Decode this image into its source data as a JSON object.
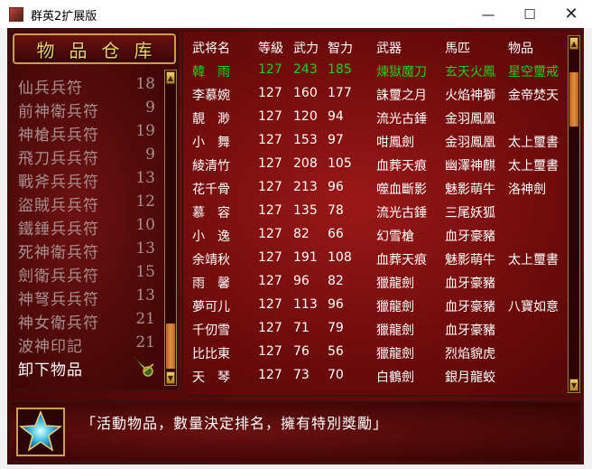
{
  "window": {
    "title": "群英2扩展版",
    "min": "—",
    "max": "☐",
    "close": "✕"
  },
  "left": {
    "title": "物品仓库",
    "items": [
      {
        "name": "仙兵兵符",
        "count": "18"
      },
      {
        "name": "前神衛兵符",
        "count": "9"
      },
      {
        "name": "神槍兵兵符",
        "count": "19"
      },
      {
        "name": "飛刀兵兵符",
        "count": "9"
      },
      {
        "name": "戰斧兵兵符",
        "count": "13"
      },
      {
        "name": "盜賊兵兵符",
        "count": "12"
      },
      {
        "name": "鐵錘兵兵符",
        "count": "10"
      },
      {
        "name": "死神衛兵符",
        "count": "13"
      },
      {
        "name": "劍衛兵兵符",
        "count": "15"
      },
      {
        "name": "神弩兵兵符",
        "count": "13"
      },
      {
        "name": "神女衛兵符",
        "count": "21"
      },
      {
        "name": "波神印記",
        "count": "21"
      },
      {
        "name": "卸下物品",
        "count": ""
      }
    ]
  },
  "table": {
    "headers": {
      "name": "武将名",
      "level": "等級",
      "atk": "武力",
      "int": "智力",
      "weapon": "武器",
      "horse": "馬匹",
      "item": "物品"
    },
    "rows": [
      {
        "name": "韓　雨",
        "level": "127",
        "atk": "243",
        "int": "185",
        "weapon": "煉獄魔刀",
        "horse": "玄天火鳳",
        "item": "星空璽戒",
        "hl": true
      },
      {
        "name": "李慕婉",
        "level": "127",
        "atk": "160",
        "int": "177",
        "weapon": "誅璽之月",
        "horse": "火焰神獅",
        "item": "金帝焚天",
        "hl": false
      },
      {
        "name": "靚　渺",
        "level": "127",
        "atk": "120",
        "int": "94",
        "weapon": "流光古錘",
        "horse": "金羽鳳凰",
        "item": "",
        "hl": false
      },
      {
        "name": "小　舞",
        "level": "127",
        "atk": "153",
        "int": "97",
        "weapon": "咁鳳劍",
        "horse": "金羽鳳凰",
        "item": "太上璽書",
        "hl": false
      },
      {
        "name": "綾清竹",
        "level": "127",
        "atk": "208",
        "int": "105",
        "weapon": "血葬天痕",
        "horse": "幽澤神麒",
        "item": "太上璽書",
        "hl": false
      },
      {
        "name": "花千骨",
        "level": "127",
        "atk": "213",
        "int": "96",
        "weapon": "噬血斷影",
        "horse": "魅影萌牛",
        "item": "洛神劍",
        "hl": false
      },
      {
        "name": "慕　容",
        "level": "127",
        "atk": "135",
        "int": "78",
        "weapon": "流光古錘",
        "horse": "三尾妖狐",
        "item": "",
        "hl": false
      },
      {
        "name": "小　逸",
        "level": "127",
        "atk": "82",
        "int": "66",
        "weapon": "幻雪槍",
        "horse": "血牙豪豬",
        "item": "",
        "hl": false
      },
      {
        "name": "余靖秋",
        "level": "127",
        "atk": "191",
        "int": "108",
        "weapon": "血葬天痕",
        "horse": "魅影萌牛",
        "item": "太上璽書",
        "hl": false
      },
      {
        "name": "雨　馨",
        "level": "127",
        "atk": "96",
        "int": "82",
        "weapon": "獵龍劍",
        "horse": "血牙豪豬",
        "item": "",
        "hl": false
      },
      {
        "name": "夢可儿",
        "level": "127",
        "atk": "113",
        "int": "96",
        "weapon": "獵龍劍",
        "horse": "血牙豪豬",
        "item": "八寶如意",
        "hl": false
      },
      {
        "name": "千仞雪",
        "level": "127",
        "atk": "71",
        "int": "79",
        "weapon": "獵龍劍",
        "horse": "血牙豪豬",
        "item": "",
        "hl": false
      },
      {
        "name": "比比東",
        "level": "127",
        "atk": "76",
        "int": "56",
        "weapon": "獵龍劍",
        "horse": "烈焰貌虎",
        "item": "",
        "hl": false
      },
      {
        "name": "天　琴",
        "level": "127",
        "atk": "73",
        "int": "70",
        "weapon": "白鶴劍",
        "horse": "銀月龍蛟",
        "item": "",
        "hl": false
      }
    ]
  },
  "message": "「活動物品，數量決定排名，擁有特別獎勵」",
  "colors": {
    "highlight": "#20d020",
    "text": "#ffffff",
    "dim": "#a89090",
    "gold": "#f0d070"
  }
}
